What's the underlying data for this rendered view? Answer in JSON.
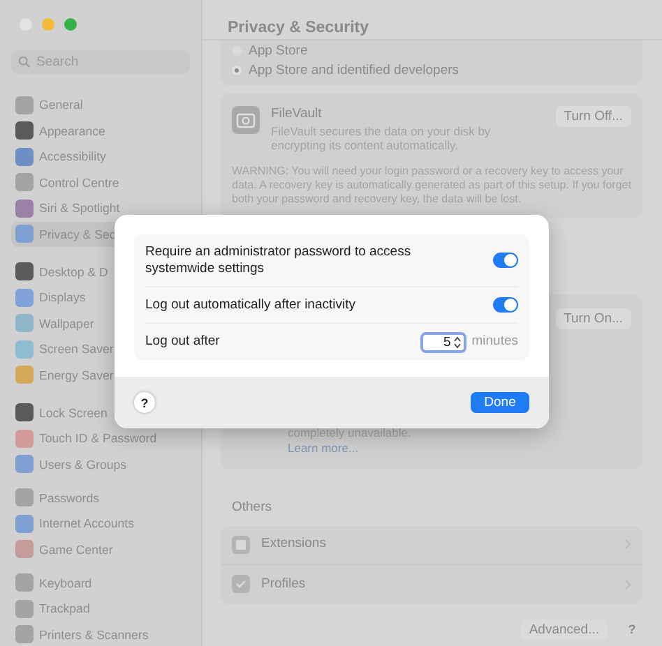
{
  "sidebar": {
    "search": {
      "placeholder": "Search"
    },
    "groups": [
      [
        {
          "label": "General",
          "selected": false,
          "color": "#a3a3a3"
        },
        {
          "label": "Appearance",
          "selected": false,
          "color": "#5a5a5a"
        },
        {
          "label": "Accessibility",
          "selected": false,
          "color": "#6f8fc4"
        },
        {
          "label": "Control Centre",
          "selected": false,
          "color": "#a3a3a3"
        },
        {
          "label": "Siri & Spotlight",
          "selected": false,
          "color": "#9a7fa6"
        },
        {
          "label": "Privacy & Sec",
          "selected": true,
          "color": "#7f9fd3"
        }
      ],
      [
        {
          "label": "Desktop & D",
          "selected": false,
          "color": "#5a5a5a"
        },
        {
          "label": "Displays",
          "selected": false,
          "color": "#7fa3d8"
        },
        {
          "label": "Wallpaper",
          "selected": false,
          "color": "#8fb6c8"
        },
        {
          "label": "Screen Saver",
          "selected": false,
          "color": "#8fbcd0"
        },
        {
          "label": "Energy Saver",
          "selected": false,
          "color": "#d6a95a"
        }
      ],
      [
        {
          "label": "Lock Screen",
          "selected": false,
          "color": "#5a5a5a"
        },
        {
          "label": "Touch ID & Password",
          "selected": false,
          "color": "#d39a9a"
        },
        {
          "label": "Users & Groups",
          "selected": false,
          "color": "#7f9fd3"
        }
      ],
      [
        {
          "label": "Passwords",
          "selected": false,
          "color": "#a3a3a3"
        },
        {
          "label": "Internet Accounts",
          "selected": false,
          "color": "#7f9fd3"
        },
        {
          "label": "Game Center",
          "selected": false,
          "color": "#c49a9a"
        }
      ],
      [
        {
          "label": "Keyboard",
          "selected": false,
          "color": "#a3a3a3"
        },
        {
          "label": "Trackpad",
          "selected": false,
          "color": "#a3a3a3"
        },
        {
          "label": "Printers & Scanners",
          "selected": false,
          "color": "#a3a3a3"
        }
      ]
    ]
  },
  "main": {
    "title": "Privacy & Security",
    "radios": [
      {
        "label": "App Store",
        "selected": false
      },
      {
        "label": "App Store and identified developers",
        "selected": true
      }
    ],
    "filevault": {
      "title": "FileVault",
      "description": "FileVault secures the data on your disk by encrypting its content automatically.",
      "button": "Turn Off...",
      "warning": "WARNING: You will need your login password or a recovery key to access your data. A recovery key is automatically generated as part of this setup. If you forget both your password and recovery key, the data will be lost."
    },
    "lockdown": {
      "button": "Turn On...",
      "text": "completely unavailable.",
      "link": "Learn more..."
    },
    "others": {
      "heading": "Others",
      "items": [
        {
          "label": "Extensions"
        },
        {
          "label": "Profiles"
        }
      ]
    },
    "advanced_button": "Advanced...",
    "help": "?"
  },
  "dialog": {
    "rows": [
      {
        "kind": "toggle",
        "label": "Require an administrator password to access systemwide settings",
        "on": true
      },
      {
        "kind": "toggle",
        "label": "Log out automatically after inactivity",
        "on": true
      },
      {
        "kind": "stepper",
        "label": "Log out after",
        "value": "5",
        "unit": "minutes"
      }
    ],
    "help": "?",
    "button": "Done"
  }
}
